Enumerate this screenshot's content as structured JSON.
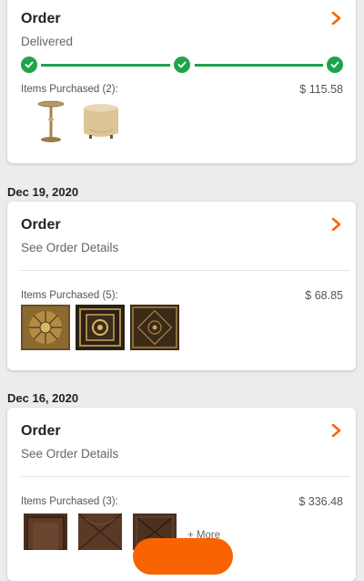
{
  "orders": [
    {
      "title": "Order",
      "status": "Delivered",
      "items_label": "Items Purchased (2):",
      "price": "$ 115.58",
      "progress_steps_complete": 3,
      "thumbnails": [
        "gold-side-table",
        "cream-round-ottoman"
      ]
    },
    {
      "date": "Dec 19, 2020",
      "title": "Order",
      "subtitle": "See Order Details",
      "items_label": "Items Purchased (5):",
      "price": "$ 68.85",
      "thumbnails": [
        "ornate-gold-ceiling-tile-floral",
        "ornate-gold-ceiling-tile-square",
        "ornate-bronze-ceiling-tile"
      ]
    },
    {
      "date": "Dec 16, 2020",
      "title": "Order",
      "subtitle": "See Order Details",
      "items_label": "Items Purchased (3):",
      "price": "$ 336.48",
      "more_label": "+ More",
      "thumbnails": [
        "brown-leather-tile-1",
        "brown-leather-tile-2",
        "brown-leather-tile-3"
      ]
    }
  ],
  "colors": {
    "accent": "#f96302",
    "success": "#1ea34b",
    "background": "#ececec"
  }
}
